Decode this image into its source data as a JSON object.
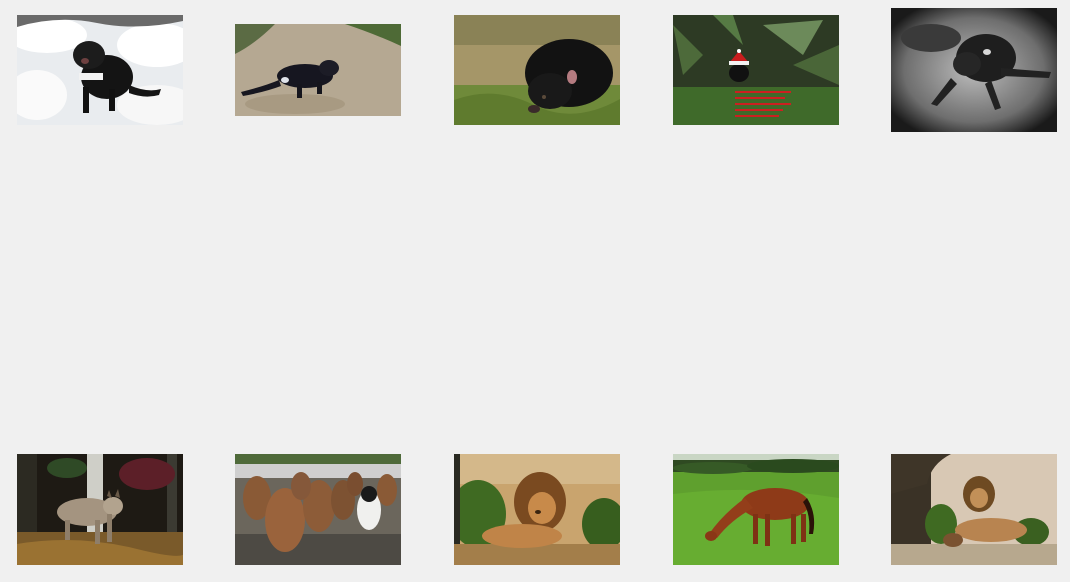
{
  "gallery": {
    "top_row": [
      {
        "subject": "tasmanian-devil-snow"
      },
      {
        "subject": "tasmanian-devil-running"
      },
      {
        "subject": "tasmanian-devil-grass"
      },
      {
        "subject": "tasmanian-devil-santa-hat"
      },
      {
        "subject": "tasmanian-devil-bw"
      }
    ],
    "bottom_row": [
      {
        "subject": "lynx-forest"
      },
      {
        "subject": "king-penguin-chicks"
      },
      {
        "subject": "lion-resting"
      },
      {
        "subject": "horse-grazing"
      },
      {
        "subject": "lion-under-tree"
      }
    ]
  }
}
